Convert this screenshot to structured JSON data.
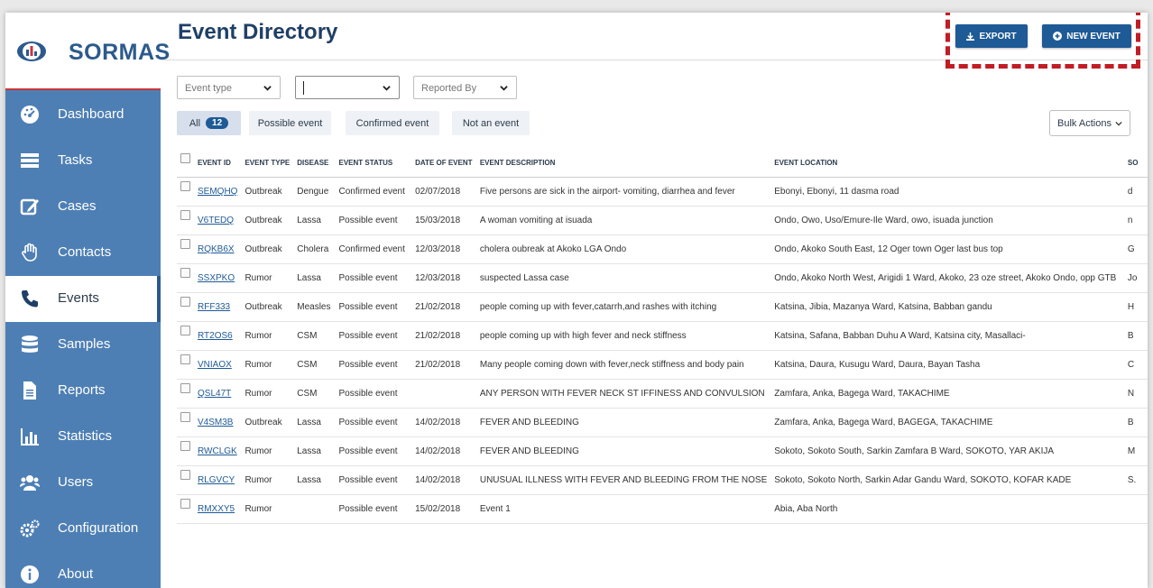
{
  "brand": {
    "name": "SORMAS",
    "logo_icon": "sormas-logo-icon"
  },
  "nav": [
    {
      "key": "dashboard",
      "label": "Dashboard",
      "icon": "dashboard-icon"
    },
    {
      "key": "tasks",
      "label": "Tasks",
      "icon": "tasks-icon"
    },
    {
      "key": "cases",
      "label": "Cases",
      "icon": "edit-icon"
    },
    {
      "key": "contacts",
      "label": "Contacts",
      "icon": "hand-icon"
    },
    {
      "key": "events",
      "label": "Events",
      "icon": "phone-icon",
      "active": true
    },
    {
      "key": "samples",
      "label": "Samples",
      "icon": "database-icon"
    },
    {
      "key": "reports",
      "label": "Reports",
      "icon": "document-icon"
    },
    {
      "key": "statistics",
      "label": "Statistics",
      "icon": "bar-chart-icon"
    },
    {
      "key": "users",
      "label": "Users",
      "icon": "users-icon"
    },
    {
      "key": "configuration",
      "label": "Configuration",
      "icon": "gears-icon"
    },
    {
      "key": "about",
      "label": "About",
      "icon": "info-icon"
    }
  ],
  "header": {
    "title": "Event Directory",
    "export_label": "EXPORT",
    "new_event_label": "NEW EVENT"
  },
  "filters": {
    "event_type_placeholder": "Event type",
    "disease_value": "",
    "reported_by_placeholder": "Reported By"
  },
  "tabs": {
    "all_label": "All",
    "all_count": "12",
    "possible_label": "Possible event",
    "confirmed_label": "Confirmed event",
    "not_event_label": "Not an event"
  },
  "bulk_actions_label": "Bulk Actions",
  "table": {
    "headers": [
      "EVENT ID",
      "EVENT TYPE",
      "DISEASE",
      "EVENT STATUS",
      "DATE OF EVENT",
      "EVENT DESCRIPTION",
      "EVENT LOCATION",
      "SO"
    ],
    "rows": [
      [
        "SEMQHQ",
        "Outbreak",
        "Dengue",
        "Confirmed event",
        "02/07/2018",
        "Five persons are sick in the airport- vomiting, diarrhea and fever",
        "Ebonyi, Ebonyi, 11 dasma road",
        "d"
      ],
      [
        "V6TEDQ",
        "Outbreak",
        "Lassa",
        "Possible event",
        "15/03/2018",
        "A woman vomiting at isuada",
        "Ondo, Owo, Uso/Emure-Ile Ward, owo, isuada junction",
        "n"
      ],
      [
        "RQKB6X",
        "Outbreak",
        "Cholera",
        "Confirmed event",
        "12/03/2018",
        "cholera oubreak at Akoko LGA Ondo",
        "Ondo, Akoko South East, 12 Oger town Oger last bus top",
        "G"
      ],
      [
        "SSXPKO",
        "Rumor",
        "Lassa",
        "Possible event",
        "12/03/2018",
        "suspected Lassa case",
        "Ondo, Akoko North West, Arigidi 1 Ward, Akoko, 23 oze street, Akoko Ondo, opp GTB",
        "Jo"
      ],
      [
        "RFF333",
        "Outbreak",
        "Measles",
        "Possible event",
        "21/02/2018",
        "people coming up with fever,catarrh,and rashes with itching",
        "Katsina, Jibia, Mazanya Ward, Katsina, Babban gandu",
        "H"
      ],
      [
        "RT2OS6",
        "Rumor",
        "CSM",
        "Possible event",
        "21/02/2018",
        "people coming up with high fever and neck stiffness",
        "Katsina, Safana, Babban Duhu A Ward, Katsina city, Masallaci-",
        "B"
      ],
      [
        "VNIAOX",
        "Rumor",
        "CSM",
        "Possible event",
        "21/02/2018",
        "Many people coming down with fever,neck stiffness and body pain",
        "Katsina, Daura, Kusugu Ward, Daura, Bayan Tasha",
        "C"
      ],
      [
        "QSL47T",
        "Rumor",
        "CSM",
        "Possible event",
        "",
        "ANY PERSON WITH FEVER NECK ST IFFINESS AND CONVULSION",
        "Zamfara, Anka, Bagega Ward, TAKACHIME",
        "N"
      ],
      [
        "V4SM3B",
        "Outbreak",
        "Lassa",
        "Possible event",
        "14/02/2018",
        "FEVER AND BLEEDING",
        "Zamfara, Anka, Bagega Ward, BAGEGA, TAKACHIME",
        "B"
      ],
      [
        "RWCLGK",
        "Rumor",
        "Lassa",
        "Possible event",
        "14/02/2018",
        "FEVER AND BLEEDING",
        "Sokoto, Sokoto South, Sarkin Zamfara B Ward, SOKOTO, YAR AKIJA",
        "M"
      ],
      [
        "RLGVCY",
        "Rumor",
        "Lassa",
        "Possible event",
        "14/02/2018",
        "UNUSUAL ILLNESS WITH FEVER AND BLEEDING FROM THE NOSE",
        "Sokoto, Sokoto North, Sarkin Adar Gandu Ward, SOKOTO, KOFAR KADE",
        "S."
      ],
      [
        "RMXXY5",
        "Rumor",
        "",
        "Possible event",
        "15/02/2018",
        "Event 1",
        "Abia, Aba North",
        ""
      ]
    ]
  },
  "colors": {
    "sidebar": "#4e7fb4",
    "primary": "#1e5a95",
    "highlight_border": "#c11d25"
  }
}
